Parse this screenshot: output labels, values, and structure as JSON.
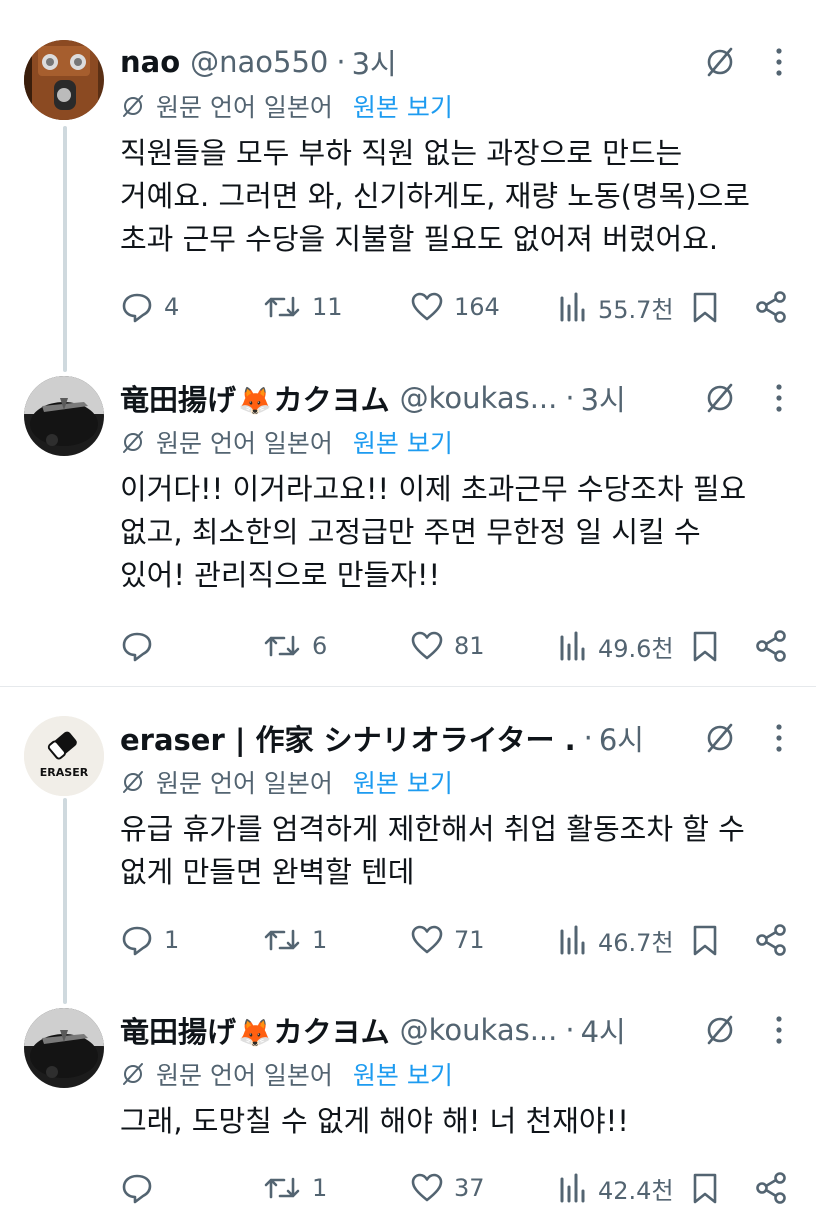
{
  "translation": {
    "label": "원문 언어 일본어",
    "show_original": "원본 보기"
  },
  "colors": {
    "text": "#0f1419",
    "secondary": "#536471",
    "accent": "#1d9bf0",
    "thread": "#cfd9de"
  },
  "tweets": [
    {
      "name": "nao",
      "handle": "@nao550",
      "dot": "·",
      "time": "3시",
      "lines": [
        "직원들을 모두 부하 직원 없는 과장으로 만드는",
        "거예요. 그러면 와, 신기하게도, 재량 노동(명목)으로",
        "초과 근무 수당을 지불할 필요도 없어져 버렸어요."
      ],
      "replies": "4",
      "reposts": "11",
      "likes": "164",
      "views": "55.7천"
    },
    {
      "name": "竜田揚げ",
      "name_emoji": "🦊",
      "name_suffix": "カクヨム",
      "handle": "@koukas...",
      "dot": "·",
      "time": "3시",
      "lines": [
        "이거다!! 이거라고요!! 이제 초과근무 수당조차 필요",
        "없고, 최소한의 고정급만 주면 무한정 일 시킬 수",
        "있어! 관리직으로 만들자!!"
      ],
      "replies": "",
      "reposts": "6",
      "likes": "81",
      "views": "49.6천"
    },
    {
      "name": "eraser | 作家 シナリオライター .",
      "avatar_text": "ERASER",
      "dot": "·",
      "time": "6시",
      "lines": [
        "유급 휴가를 엄격하게 제한해서 취업 활동조차 할 수",
        "없게 만들면 완벽할 텐데"
      ],
      "replies": "1",
      "reposts": "1",
      "likes": "71",
      "views": "46.7천"
    },
    {
      "name": "竜田揚げ",
      "name_emoji": "🦊",
      "name_suffix": "カクヨム",
      "handle": "@koukas...",
      "dot": "·",
      "time": "4시",
      "lines": [
        "그래, 도망칠 수 없게 해야 해! 너 천재야!!"
      ],
      "replies": "",
      "reposts": "1",
      "likes": "37",
      "views": "42.4천"
    }
  ]
}
